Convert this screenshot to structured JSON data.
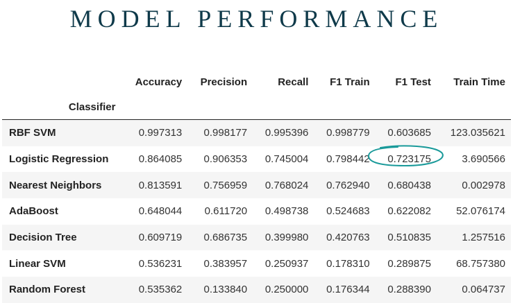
{
  "page": {
    "title": "MODEL PERFORMANCE"
  },
  "table": {
    "index_name": "Classifier",
    "columns": [
      "Accuracy",
      "Precision",
      "Recall",
      "F1 Train",
      "F1 Test",
      "Train Time"
    ],
    "rows": [
      {
        "label": "RBF SVM",
        "values": [
          "0.997313",
          "0.998177",
          "0.995396",
          "0.998779",
          "0.603685",
          "123.035621"
        ]
      },
      {
        "label": "Logistic Regression",
        "values": [
          "0.864085",
          "0.906353",
          "0.745004",
          "0.798442",
          "0.723175",
          "3.690566"
        ]
      },
      {
        "label": "Nearest Neighbors",
        "values": [
          "0.813591",
          "0.756959",
          "0.768024",
          "0.762940",
          "0.680438",
          "0.002978"
        ]
      },
      {
        "label": "AdaBoost",
        "values": [
          "0.648044",
          "0.611720",
          "0.498738",
          "0.524683",
          "0.622082",
          "52.076174"
        ]
      },
      {
        "label": "Decision Tree",
        "values": [
          "0.609719",
          "0.686735",
          "0.399980",
          "0.420763",
          "0.510835",
          "1.257516"
        ]
      },
      {
        "label": "Linear SVM",
        "values": [
          "0.536231",
          "0.383957",
          "0.250937",
          "0.178310",
          "0.289875",
          "68.757380"
        ]
      },
      {
        "label": "Random Forest",
        "values": [
          "0.535362",
          "0.133840",
          "0.250000",
          "0.176344",
          "0.288390",
          "0.064737"
        ]
      }
    ]
  },
  "annotation": {
    "circle_color": "#1a9a9a"
  }
}
